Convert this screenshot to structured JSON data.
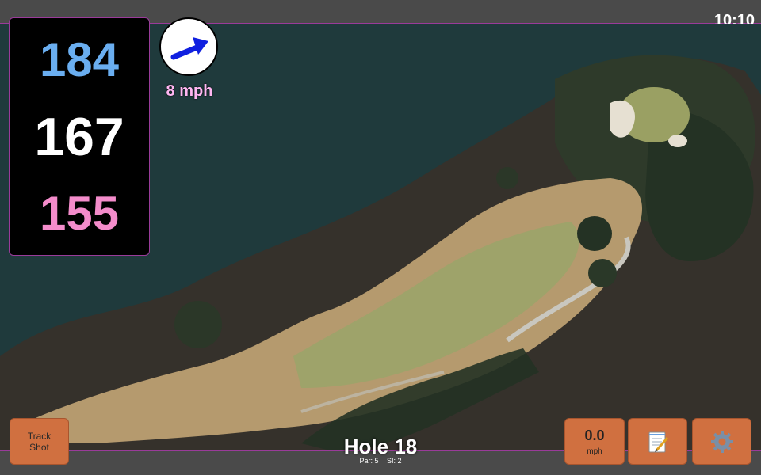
{
  "status_bar": {
    "time": "10:10"
  },
  "distances": {
    "back": "184",
    "center": "167",
    "front": "155"
  },
  "wind": {
    "speed": "8 mph",
    "icon": "wind-direction-arrow-icon"
  },
  "buttons": {
    "track_shot_line1": "Track",
    "track_shot_line2": "Shot",
    "speed_value": "0.0",
    "speed_unit": "mph",
    "notes_icon": "notepad-icon",
    "settings_icon": "gear-icon"
  },
  "hole": {
    "title": "Hole 18",
    "par": "Par: 5",
    "si": "SI: 2"
  },
  "colors": {
    "back_distance": "#6aaef0",
    "center_distance": "#ffffff",
    "front_distance": "#f48ccb",
    "button": "#d07040",
    "wind_text": "#ffb6f2"
  }
}
